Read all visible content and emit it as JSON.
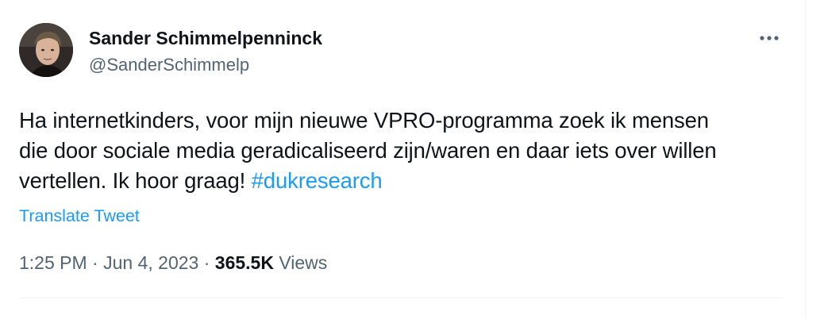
{
  "author": {
    "display_name": "Sander Schimmelpenninck",
    "handle": "@SanderSchimmelp",
    "avatar_icon": "profile-photo"
  },
  "more_icon": "more-horizontal-icon",
  "tweet": {
    "text_lines": [
      "Ha internetkinders, voor mijn nieuwe VPRO-programma zoek ik mensen",
      "die door sociale media geradicaliseerd zijn/waren en daar iets over willen",
      "vertellen. Ik hoor graag! "
    ],
    "hashtag": "#dukresearch",
    "translate_label": "Translate Tweet"
  },
  "meta": {
    "time": "1:25 PM",
    "separator": " · ",
    "date": "Jun 4, 2023",
    "views_count": "365.5K",
    "views_label": " Views"
  },
  "colors": {
    "link": "#1d9bf0",
    "secondary_text": "#536471",
    "primary_text": "#0f1419",
    "divider": "#eff3f4"
  }
}
